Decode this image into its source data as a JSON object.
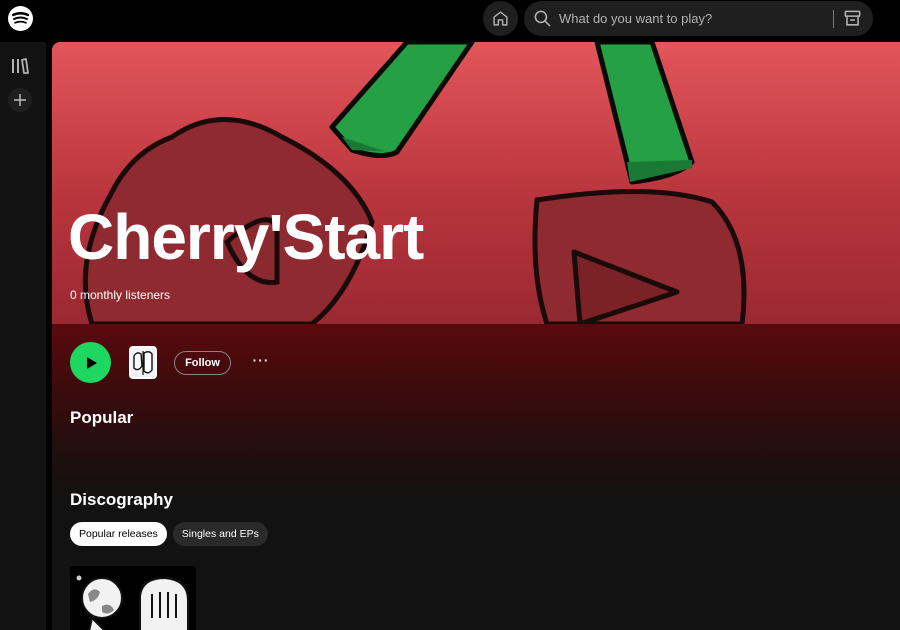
{
  "topbar": {
    "search_placeholder": "What do you want to play?"
  },
  "artist": {
    "name": "Cherry'Start",
    "monthly_listeners": "0 monthly listeners"
  },
  "actions": {
    "follow_label": "Follow",
    "more_label": "···"
  },
  "sections": {
    "popular": "Popular",
    "discography": "Discography"
  },
  "discography_filters": [
    {
      "label": "Popular releases",
      "active": true
    },
    {
      "label": "Singles and EPs",
      "active": false
    }
  ],
  "colors": {
    "accent_green": "#1ed760",
    "hero_red": "#e3565a",
    "background": "#121212"
  },
  "icons": [
    "spotify-logo-icon",
    "home-icon",
    "search-icon",
    "browse-icon",
    "library-icon",
    "plus-icon",
    "play-icon"
  ]
}
